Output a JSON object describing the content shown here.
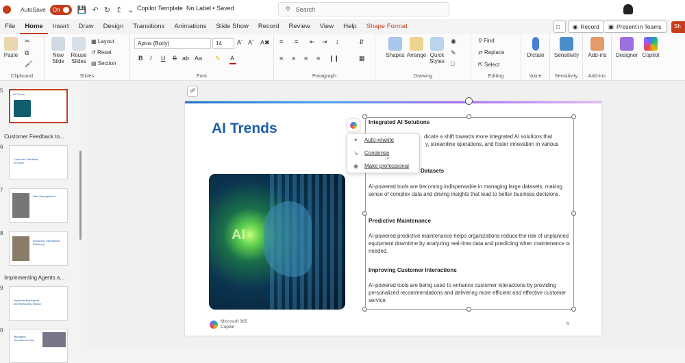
{
  "titlebar": {
    "autosave_label": "AutoSave",
    "toggle_state": "On",
    "doc_title": "Copilot Template",
    "label_status": "No Label • Saved",
    "search_placeholder": "Search",
    "share": "Sh"
  },
  "tabs": [
    "File",
    "Home",
    "Insert",
    "Draw",
    "Design",
    "Transitions",
    "Animations",
    "Slide Show",
    "Record",
    "Review",
    "View",
    "Help",
    "Shape Format"
  ],
  "top_buttons": {
    "record": "Record",
    "present_teams": "Present in Teams"
  },
  "ribbon": {
    "clipboard": {
      "paste": "Paste",
      "name": "Clipboard"
    },
    "slides": {
      "new_slide": "New Slide",
      "reuse_slides": "Reuse Slides",
      "layout": "Layout",
      "reset": "Reset",
      "section": "Section",
      "name": "Slides"
    },
    "font": {
      "font_name": "Aptos (Body)",
      "font_size": "14",
      "bold": "B",
      "italic": "I",
      "underline": "U",
      "strike": "S",
      "name": "Font"
    },
    "paragraph": {
      "name": "Paragraph"
    },
    "drawing": {
      "shapes": "Shapes",
      "arrange": "Arrange",
      "quick_styles": "Quick Styles",
      "name": "Drawing"
    },
    "editing": {
      "find": "Find",
      "replace": "Replace",
      "select": "Select",
      "name": "Editing"
    },
    "voice": {
      "dictate": "Dictate",
      "name": "Voice"
    },
    "sensitivity": {
      "label": "Sensitivity",
      "name": "Sensitivity"
    },
    "addins": {
      "label": "Add-ins",
      "name": "Add-ins"
    },
    "designer": "Designer",
    "copilot": "Copilot"
  },
  "slides_panel": {
    "items": [
      {
        "num": "5",
        "title": "AI Trends"
      },
      {
        "num": "6",
        "title": "Customer Feedback to Action"
      },
      {
        "num": "7",
        "title": "Data Management"
      },
      {
        "num": "8",
        "title": "Improving Operational Efficiency"
      },
      {
        "num": "9",
        "title": "Implementing Agents and Measuring Impact"
      },
      {
        "num": "0",
        "title": "Managing Operational Risk"
      }
    ],
    "sections": [
      "Customer Feedback to...",
      "Implementing Agents a..."
    ]
  },
  "slide": {
    "title": "AI Trends",
    "image_text": "AI",
    "headings": [
      "Integrated AI Solutions",
      "Datasets",
      "Predictive Maintenance",
      "Improving Customer Interactions"
    ],
    "paragraphs": [
      "dicate a shift towards more integrated AI solutions that",
      "y, streamline operations, and foster innovation in various",
      "AI-powered tools are becoming indispensable in managing large datasets, making sense of complex data and driving insights that lead to better business decisions.",
      "AI-powered predictive maintenance helps organizations reduce the risk of unplanned equipment downtime by analyzing real-time data and predicting when maintenance is needed.",
      "AI-powered tools are being used to enhance customer interactions by providing personalized recommendations and delivering more efficient and effective customer service."
    ],
    "footer": "Microsoft 365 Copilot",
    "page_number": "5"
  },
  "copilot_menu": {
    "items": [
      "Auto-rewrite",
      "Condense",
      "Make professional"
    ]
  }
}
